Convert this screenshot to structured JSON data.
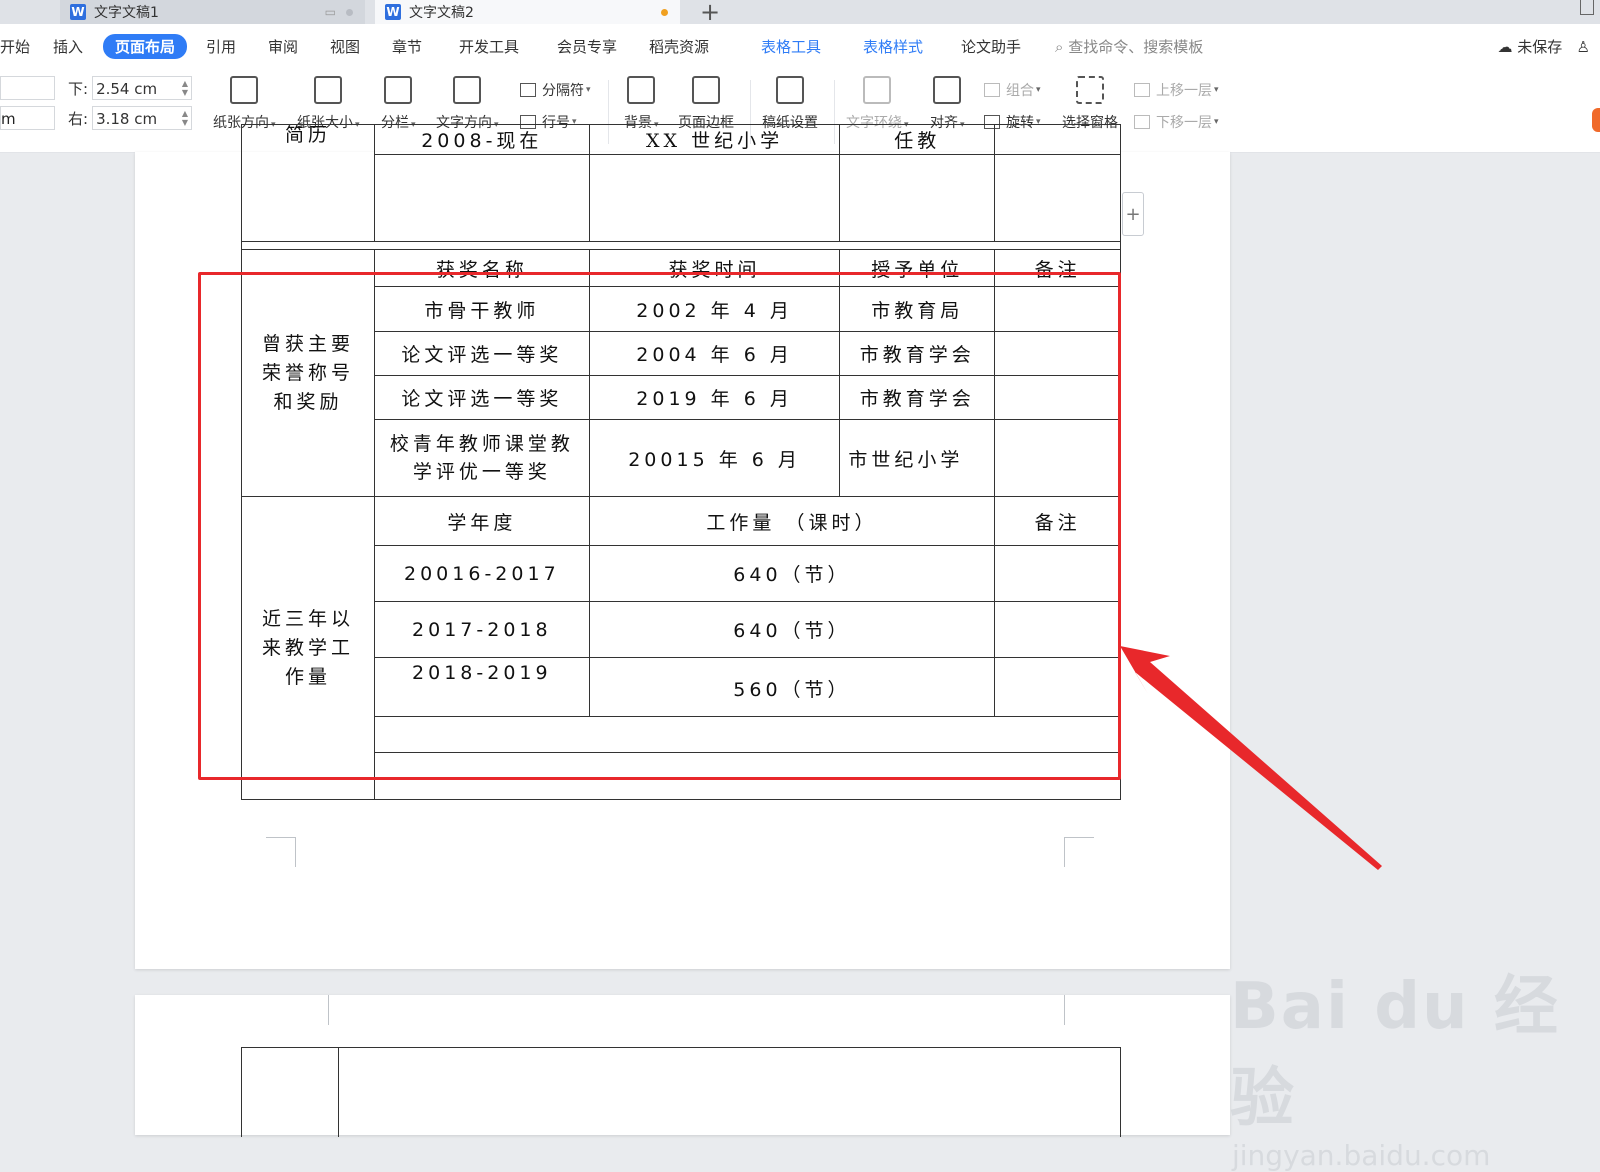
{
  "tabs": [
    {
      "title": "文字文稿1"
    },
    {
      "title": "文字文稿2"
    }
  ],
  "tab_new": "+",
  "menu": {
    "items": [
      "开始",
      "插入",
      "页面布局",
      "引用",
      "审阅",
      "视图",
      "章节",
      "开发工具",
      "会员专享",
      "稻壳资源",
      "表格工具",
      "表格样式",
      "论文助手"
    ],
    "active": "页面布局",
    "search": "查找命令、搜索模板",
    "unsaved": "未保存"
  },
  "ribbon": {
    "stub_top": "",
    "stub_bottom": "m",
    "bottom_label": "下:",
    "bottom_value": "2.54 cm",
    "right_label": "右:",
    "right_value": "3.18 cm",
    "orientation": "纸张方向",
    "size": "纸张大小",
    "columns": "分栏",
    "text_direction": "文字方向",
    "separator": "分隔符",
    "line_number": "行号",
    "background": "背景",
    "page_border": "页面边框",
    "manuscript": "稿纸设置",
    "text_wrap": "文字环绕",
    "align": "对齐",
    "group": "组合",
    "rotate": "旋转",
    "selection_pane": "选择窗格",
    "bring_forward": "上移一层",
    "send_backward": "下移一层"
  },
  "doc": {
    "resume_label_partial": "简历",
    "resume_row": {
      "period": "2008-现在",
      "school": "XX 世纪小学",
      "role": "任教"
    },
    "awards_label": "曾获主要荣誉称号和奖励",
    "awards_header": [
      "获奖名称",
      "获奖时间",
      "授予单位",
      "备注"
    ],
    "awards": [
      {
        "name": "市骨干教师",
        "date": "2002 年 4 月",
        "org": "市教育局"
      },
      {
        "name": "论文评选一等奖",
        "date": "2004 年 6 月",
        "org": "市教育学会"
      },
      {
        "name": "论文评选一等奖",
        "date": "2019 年 6 月",
        "org": "市教育学会"
      },
      {
        "name": "校青年教师课堂教学评优一等奖",
        "date": "20015 年 6 月",
        "org": "市世纪小学"
      }
    ],
    "workload_label": "近三年以来教学工作量",
    "workload_header": [
      "学年度",
      "工作量 （课时）",
      "备注"
    ],
    "workload": [
      {
        "year": "20016-2017",
        "hours": "640（节）"
      },
      {
        "year": "2017-2018",
        "hours": "640（节）"
      },
      {
        "year": "2018-2019",
        "hours": "560（节）"
      }
    ]
  },
  "watermark": {
    "logo": "Bai du 经验",
    "url": "jingyan.baidu.com"
  },
  "colors": {
    "accent": "#2f7cf6",
    "highlight": "#e8282b",
    "arrow": "#e8282b"
  }
}
